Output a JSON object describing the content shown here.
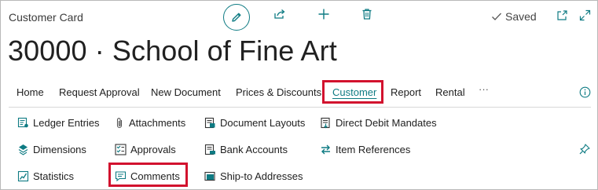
{
  "window": {
    "card_title": "Customer Card",
    "saved_label": "Saved"
  },
  "record": {
    "title": "30000 · School of Fine Art"
  },
  "tabs": [
    {
      "label": "Home"
    },
    {
      "label": "Request Approval"
    },
    {
      "label": "New Document"
    },
    {
      "label": "Prices & Discounts"
    },
    {
      "label": "Customer"
    },
    {
      "label": "Report"
    },
    {
      "label": "Rental"
    },
    {
      "label": "···"
    }
  ],
  "menu": {
    "col1": [
      {
        "label": "Ledger Entries",
        "icon": "ledger-icon"
      },
      {
        "label": "Dimensions",
        "icon": "dimensions-icon"
      },
      {
        "label": "Statistics",
        "icon": "statistics-icon"
      }
    ],
    "col2": [
      {
        "label": "Attachments",
        "icon": "paperclip-icon"
      },
      {
        "label": "Approvals",
        "icon": "approvals-icon"
      },
      {
        "label": "Comments",
        "icon": "comment-icon"
      }
    ],
    "col3": [
      {
        "label": "Document Layouts",
        "icon": "document-layout-icon"
      },
      {
        "label": "Bank Accounts",
        "icon": "bank-icon"
      },
      {
        "label": "Ship-to Addresses",
        "icon": "address-icon"
      }
    ],
    "col4": [
      {
        "label": "Direct Debit Mandates",
        "icon": "mandate-icon"
      },
      {
        "label": "Item References",
        "icon": "exchange-icon"
      }
    ]
  },
  "colors": {
    "accent": "#0e7b83",
    "highlight": "#d2122e"
  }
}
